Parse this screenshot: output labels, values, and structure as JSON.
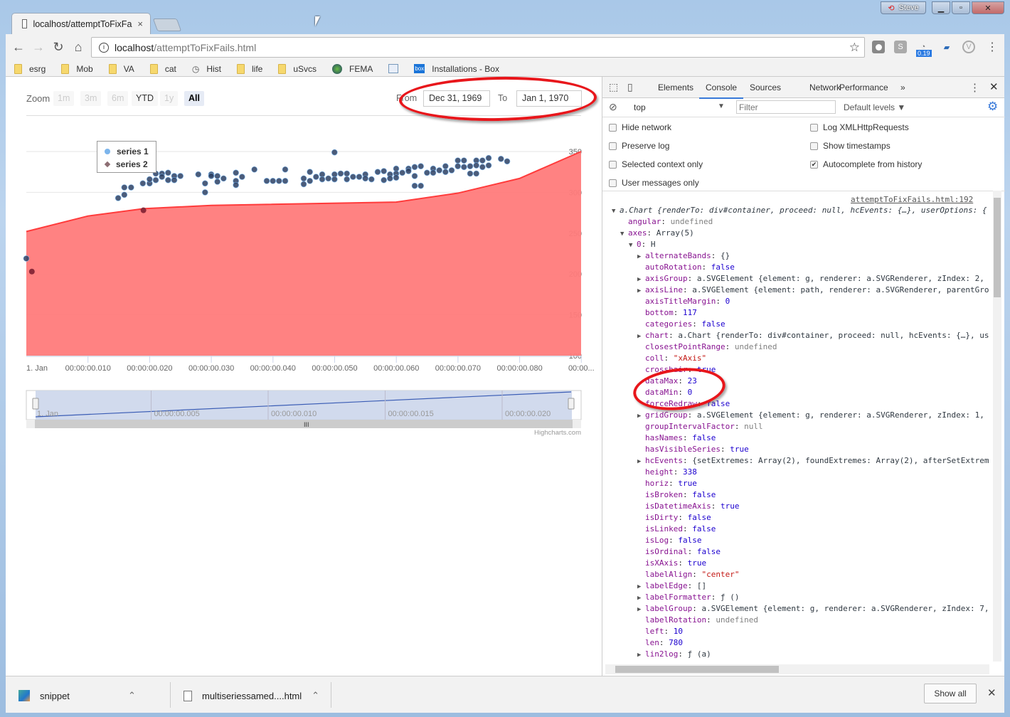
{
  "window": {
    "profile": "Steve",
    "buttons": [
      "minimize",
      "maximize",
      "close"
    ]
  },
  "tab": {
    "title": "localhost/attemptToFixFa",
    "close": "×"
  },
  "toolbar": {
    "url_host": "localhost",
    "url_path": "/attemptToFixFails.html",
    "ext_badge": "0.19",
    "ext_s": "S"
  },
  "bookmarks": [
    {
      "label": "esrg",
      "icon": "folder-icon"
    },
    {
      "label": "Mob",
      "icon": "folder-icon"
    },
    {
      "label": "VA",
      "icon": "folder-icon"
    },
    {
      "label": "cat",
      "icon": "folder-icon"
    },
    {
      "label": "Hist",
      "icon": "history-icon"
    },
    {
      "label": "life",
      "icon": "folder-icon"
    },
    {
      "label": "uSvcs",
      "icon": "folder-icon"
    },
    {
      "label": "FEMA",
      "icon": "globe-icon"
    },
    {
      "label": "",
      "icon": "calendar-icon"
    },
    {
      "label": "Installations - Box",
      "icon": "box-icon"
    }
  ],
  "range_selector": {
    "zoom_label": "Zoom",
    "buttons": [
      {
        "label": "1m",
        "state": "disabled"
      },
      {
        "label": "3m",
        "state": "disabled"
      },
      {
        "label": "6m",
        "state": "disabled"
      },
      {
        "label": "YTD",
        "state": "enabled"
      },
      {
        "label": "1y",
        "state": "disabled"
      },
      {
        "label": "All",
        "state": "selected"
      }
    ],
    "from_label": "From",
    "from_value": "Dec 31, 1969",
    "to_label": "To",
    "to_value": "Jan 1, 1970"
  },
  "chart_data": {
    "type": "scatter+area",
    "ylim": [
      100,
      350
    ],
    "y_ticks": [
      "100",
      "150",
      "200",
      "250",
      "300",
      "350"
    ],
    "x_unit": "ms",
    "xlim": [
      0,
      90
    ],
    "x_ticks": [
      "1. Jan",
      "00:00:00.010",
      "00:00:00.020",
      "00:00:00.030",
      "00:00:00.040",
      "00:00:00.050",
      "00:00:00.060",
      "00:00:00.070",
      "00:00:00.080",
      "00:00..."
    ],
    "legend": {
      "position": "top-left",
      "items": [
        "series 1",
        "series 2"
      ]
    },
    "grid": true,
    "colors": {
      "series1": "#7cb5ec",
      "series2": "#8d6e73",
      "area": "#ff7b7b",
      "area_line": "#ff3b3b",
      "marker": "#2b3f63"
    },
    "series": [
      {
        "name": "series 1",
        "type": "scatter",
        "points": [
          [
            0,
            219
          ],
          [
            14.9,
            293
          ],
          [
            15.9,
            297
          ],
          [
            15.9,
            306
          ],
          [
            17,
            306
          ],
          [
            18.9,
            311
          ],
          [
            20,
            311
          ],
          [
            20,
            316
          ],
          [
            21,
            315
          ],
          [
            21,
            323
          ],
          [
            22,
            323
          ],
          [
            22,
            319
          ],
          [
            23,
            324
          ],
          [
            23,
            315
          ],
          [
            24,
            320
          ],
          [
            24,
            315
          ],
          [
            25,
            320
          ],
          [
            27.9,
            322
          ],
          [
            29,
            311
          ],
          [
            29,
            300
          ],
          [
            30,
            322
          ],
          [
            30,
            320
          ],
          [
            31,
            320
          ],
          [
            31,
            313
          ],
          [
            32,
            317
          ],
          [
            34,
            324
          ],
          [
            34,
            314
          ],
          [
            34,
            309
          ],
          [
            35,
            319
          ],
          [
            37,
            328
          ],
          [
            39,
            314
          ],
          [
            40,
            314
          ],
          [
            41,
            314
          ],
          [
            42,
            314
          ],
          [
            42,
            328
          ],
          [
            45,
            317
          ],
          [
            45,
            310
          ],
          [
            46,
            325
          ],
          [
            46,
            314
          ],
          [
            47,
            319
          ],
          [
            48,
            322
          ],
          [
            48,
            316
          ],
          [
            49,
            317
          ],
          [
            50,
            349
          ],
          [
            50,
            322
          ],
          [
            50,
            316
          ],
          [
            51,
            323
          ],
          [
            52,
            323
          ],
          [
            52,
            316
          ],
          [
            53,
            319
          ],
          [
            54,
            319
          ],
          [
            55,
            322
          ],
          [
            55,
            317
          ],
          [
            56,
            316
          ],
          [
            57,
            325
          ],
          [
            58,
            326
          ],
          [
            58,
            315
          ],
          [
            59,
            322
          ],
          [
            59,
            317
          ],
          [
            60,
            329
          ],
          [
            60,
            323
          ],
          [
            60,
            318
          ],
          [
            61,
            324
          ],
          [
            62,
            329
          ],
          [
            62,
            326
          ],
          [
            63,
            331
          ],
          [
            63,
            320
          ],
          [
            63,
            308
          ],
          [
            64,
            332
          ],
          [
            64,
            308
          ],
          [
            65,
            324
          ],
          [
            66,
            329
          ],
          [
            66,
            324
          ],
          [
            67,
            327
          ],
          [
            68,
            332
          ],
          [
            68,
            325
          ],
          [
            69,
            327
          ],
          [
            70,
            339
          ],
          [
            70,
            332
          ],
          [
            71,
            339
          ],
          [
            71,
            331
          ],
          [
            72,
            332
          ],
          [
            72,
            323
          ],
          [
            73,
            339
          ],
          [
            73,
            333
          ],
          [
            73,
            323
          ],
          [
            74,
            339
          ],
          [
            74,
            331
          ],
          [
            75,
            342
          ],
          [
            75,
            333
          ],
          [
            77,
            341
          ],
          [
            78,
            338
          ]
        ]
      },
      {
        "name": "series 2",
        "type": "area",
        "points": [
          [
            0,
            252
          ],
          [
            10,
            271
          ],
          [
            19,
            280
          ],
          [
            30,
            284
          ],
          [
            60,
            288
          ],
          [
            70,
            299
          ],
          [
            80,
            317
          ],
          [
            90,
            350
          ]
        ],
        "markers": [
          [
            0.9,
            203
          ],
          [
            19,
            278
          ]
        ]
      }
    ],
    "navigator": {
      "x_ticks": [
        "1. Jan",
        "00:00:00.005",
        "00:00:00.010",
        "00:00:00.015",
        "00:00:00.020"
      ]
    },
    "credits": "Highcharts.com"
  },
  "devtools": {
    "tabs": [
      "Elements",
      "Console",
      "Sources",
      "Network",
      "Performance",
      "»"
    ],
    "active_tab": "Console",
    "context": "top",
    "filter_placeholder": "Filter",
    "levels": "Default levels ▼",
    "settings": [
      {
        "label": "Hide network",
        "checked": false
      },
      {
        "label": "Log XMLHttpRequests",
        "checked": false
      },
      {
        "label": "Preserve log",
        "checked": false
      },
      {
        "label": "Show timestamps",
        "checked": false
      },
      {
        "label": "Selected context only",
        "checked": false
      },
      {
        "label": "Autocomplete from history",
        "checked": true
      },
      {
        "label": "User messages only",
        "checked": false
      }
    ],
    "source_link": "attemptToFixFails.html:192",
    "lines": [
      {
        "i": 0,
        "a": "▼",
        "k": "",
        "v": "a.Chart {renderTo: div#container, proceed: null, hcEvents: {…}, userOptions: {",
        "c": "obj",
        "it": true
      },
      {
        "i": 1,
        "a": "",
        "k": "angular",
        "v": "undefined",
        "c": "undef"
      },
      {
        "i": 1,
        "a": "▼",
        "k": "axes",
        "v": "Array(5)",
        "c": "obj"
      },
      {
        "i": 2,
        "a": "▼",
        "k": "0",
        "v": "H",
        "c": "obj"
      },
      {
        "i": 3,
        "a": "▶",
        "k": "alternateBands",
        "v": "{}",
        "c": "obj"
      },
      {
        "i": 3,
        "a": "",
        "k": "autoRotation",
        "v": "false",
        "c": "num"
      },
      {
        "i": 3,
        "a": "▶",
        "k": "axisGroup",
        "v": "a.SVGElement {element: g, renderer: a.SVGRenderer, zIndex: 2,",
        "c": "obj"
      },
      {
        "i": 3,
        "a": "▶",
        "k": "axisLine",
        "v": "a.SVGElement {element: path, renderer: a.SVGRenderer, parentGro",
        "c": "obj"
      },
      {
        "i": 3,
        "a": "",
        "k": "axisTitleMargin",
        "v": "0",
        "c": "num"
      },
      {
        "i": 3,
        "a": "",
        "k": "bottom",
        "v": "117",
        "c": "num"
      },
      {
        "i": 3,
        "a": "",
        "k": "categories",
        "v": "false",
        "c": "num"
      },
      {
        "i": 3,
        "a": "▶",
        "k": "chart",
        "v": "a.Chart {renderTo: div#container, proceed: null, hcEvents: {…}, us",
        "c": "obj"
      },
      {
        "i": 3,
        "a": "",
        "k": "closestPointRange",
        "v": "undefined",
        "c": "undef"
      },
      {
        "i": 3,
        "a": "",
        "k": "coll",
        "v": "\"xAxis\"",
        "c": "str"
      },
      {
        "i": 3,
        "a": "",
        "k": "crosshair",
        "v": "true",
        "c": "num"
      },
      {
        "i": 3,
        "a": "",
        "k": "dataMax",
        "v": "23",
        "c": "num"
      },
      {
        "i": 3,
        "a": "",
        "k": "dataMin",
        "v": "0",
        "c": "num"
      },
      {
        "i": 3,
        "a": "",
        "k": "forceRedraw",
        "v": "false",
        "c": "num"
      },
      {
        "i": 3,
        "a": "▶",
        "k": "gridGroup",
        "v": "a.SVGElement {element: g, renderer: a.SVGRenderer, zIndex: 1,",
        "c": "obj"
      },
      {
        "i": 3,
        "a": "",
        "k": "groupIntervalFactor",
        "v": "null",
        "c": "undef"
      },
      {
        "i": 3,
        "a": "",
        "k": "hasNames",
        "v": "false",
        "c": "num"
      },
      {
        "i": 3,
        "a": "",
        "k": "hasVisibleSeries",
        "v": "true",
        "c": "num"
      },
      {
        "i": 3,
        "a": "▶",
        "k": "hcEvents",
        "v": "{setExtremes: Array(2), foundExtremes: Array(2), afterSetExtrem",
        "c": "obj"
      },
      {
        "i": 3,
        "a": "",
        "k": "height",
        "v": "338",
        "c": "num"
      },
      {
        "i": 3,
        "a": "",
        "k": "horiz",
        "v": "true",
        "c": "num"
      },
      {
        "i": 3,
        "a": "",
        "k": "isBroken",
        "v": "false",
        "c": "num"
      },
      {
        "i": 3,
        "a": "",
        "k": "isDatetimeAxis",
        "v": "true",
        "c": "num"
      },
      {
        "i": 3,
        "a": "",
        "k": "isDirty",
        "v": "false",
        "c": "num"
      },
      {
        "i": 3,
        "a": "",
        "k": "isLinked",
        "v": "false",
        "c": "num"
      },
      {
        "i": 3,
        "a": "",
        "k": "isLog",
        "v": "false",
        "c": "num"
      },
      {
        "i": 3,
        "a": "",
        "k": "isOrdinal",
        "v": "false",
        "c": "num"
      },
      {
        "i": 3,
        "a": "",
        "k": "isXAxis",
        "v": "true",
        "c": "num"
      },
      {
        "i": 3,
        "a": "",
        "k": "labelAlign",
        "v": "\"center\"",
        "c": "str"
      },
      {
        "i": 3,
        "a": "▶",
        "k": "labelEdge",
        "v": "[]",
        "c": "obj"
      },
      {
        "i": 3,
        "a": "▶",
        "k": "labelFormatter",
        "v": "ƒ ()",
        "c": "obj"
      },
      {
        "i": 3,
        "a": "▶",
        "k": "labelGroup",
        "v": "a.SVGElement {element: g, renderer: a.SVGRenderer, zIndex: 7,",
        "c": "obj"
      },
      {
        "i": 3,
        "a": "",
        "k": "labelRotation",
        "v": "undefined",
        "c": "undef"
      },
      {
        "i": 3,
        "a": "",
        "k": "left",
        "v": "10",
        "c": "num"
      },
      {
        "i": 3,
        "a": "",
        "k": "len",
        "v": "780",
        "c": "num"
      },
      {
        "i": 3,
        "a": "▶",
        "k": "lin2log",
        "v": "ƒ (a)",
        "c": "obj"
      }
    ]
  },
  "downloads": {
    "items": [
      {
        "name": "snippet"
      },
      {
        "name": "multiseriessamed....html"
      }
    ],
    "show_all": "Show all",
    "close": "✕"
  }
}
